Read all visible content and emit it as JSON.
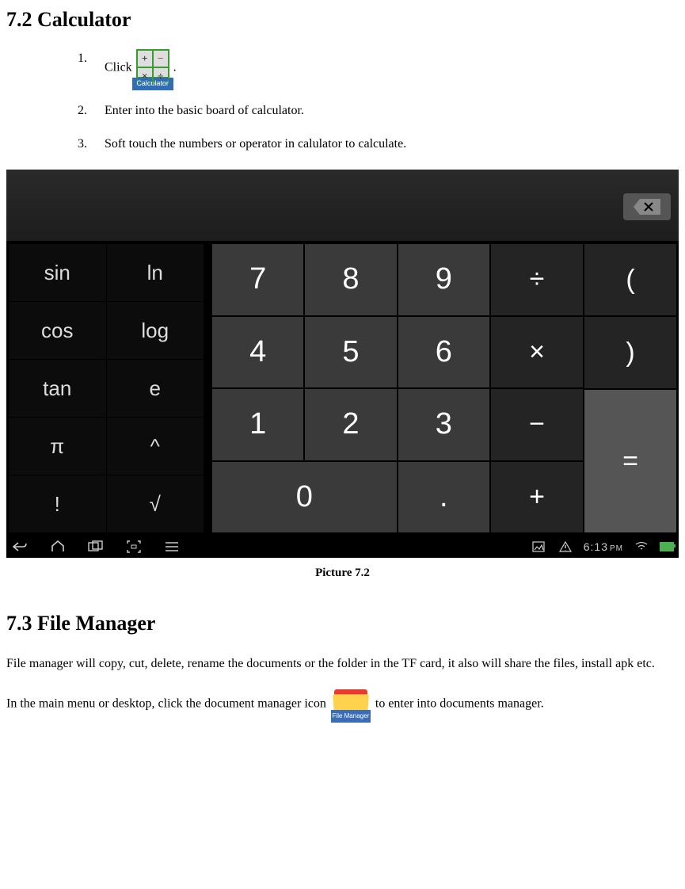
{
  "section1": {
    "title": "7.2 Calculator",
    "steps": [
      {
        "num": "1.",
        "text_pre": "Click",
        "text_post": ".",
        "icon_label": "Calculator"
      },
      {
        "num": "2.",
        "text": "Enter into the basic board of calculator."
      },
      {
        "num": "3.",
        "text": "Soft touch the numbers or operator in calulator to calculate."
      }
    ]
  },
  "calculator": {
    "sci_keys": [
      "sin",
      "ln",
      "cos",
      "log",
      "tan",
      "e",
      "π",
      "^",
      "!",
      "√"
    ],
    "num_keys_row1": [
      "7",
      "8",
      "9"
    ],
    "num_keys_row2": [
      "4",
      "5",
      "6"
    ],
    "num_keys_row3": [
      "1",
      "2",
      "3"
    ],
    "num_keys_row4": [
      "0",
      "."
    ],
    "op_keys": [
      "÷",
      "×",
      "−",
      "+"
    ],
    "paren_keys": [
      "(",
      ")"
    ],
    "equals": "="
  },
  "navbar": {
    "time": "6:13",
    "time_suffix": "PM"
  },
  "caption1": "Picture 7.2",
  "section2": {
    "title": "7.3 File Manager",
    "p1": "File manager will copy, cut, delete, rename the documents or the folder in the TF card, it also will share the files, install apk etc.",
    "p2_pre": "In the main menu or desktop, click the document manager icon ",
    "p2_post": " to enter into documents manager.",
    "icon_label": "File Manager"
  }
}
